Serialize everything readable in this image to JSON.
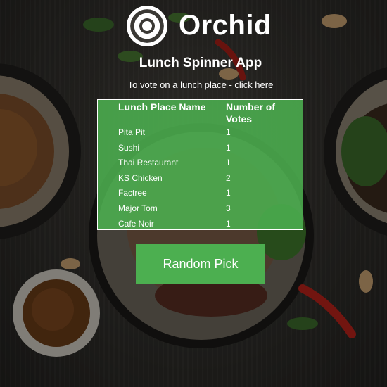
{
  "brand": {
    "name": "Orchid",
    "accent_color": "#4caf50"
  },
  "header": {
    "title": "Lunch Spinner App",
    "vote_prompt": "To vote on a lunch place - ",
    "vote_link": "click here"
  },
  "table": {
    "columns": [
      "Lunch Place Name",
      "Number of Votes"
    ],
    "rows": [
      {
        "name": "Pita Pit",
        "votes": "1"
      },
      {
        "name": "Sushi",
        "votes": "1"
      },
      {
        "name": "Thai Restaurant",
        "votes": "1"
      },
      {
        "name": "KS Chicken",
        "votes": "2"
      },
      {
        "name": "Factree",
        "votes": "1"
      },
      {
        "name": "Major Tom",
        "votes": "3"
      },
      {
        "name": "Cafe Noir",
        "votes": "1"
      }
    ]
  },
  "actions": {
    "random_pick": "Random Pick"
  }
}
